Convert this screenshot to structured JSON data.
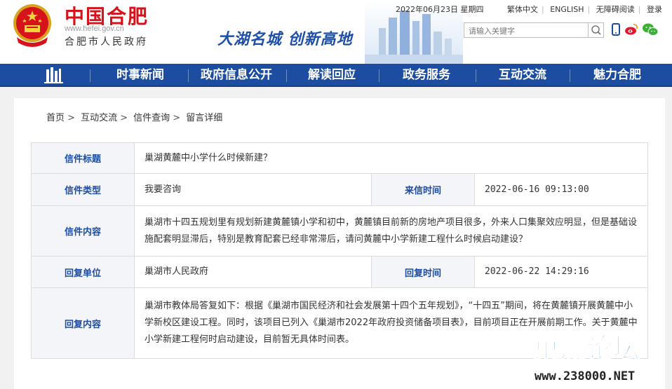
{
  "header": {
    "title": "中国合肥",
    "url": "www.hefei.gov.cn",
    "subtitle": "合肥市人民政府",
    "slogan": "大湖名城  创新高地",
    "date": "2022年06月23日 星期四",
    "links": [
      "繁体中文",
      "ENGLISH",
      "无障碍阅读",
      "登录"
    ],
    "search_placeholder": "请输入关键字"
  },
  "nav": {
    "items": [
      "时事新闻",
      "政府信息公开",
      "解读回应",
      "政务服务",
      "互动交流",
      "魅力合肥"
    ]
  },
  "breadcrumb": [
    "首页",
    "互动交流",
    "信件查询",
    "留言详细"
  ],
  "letter": {
    "title_label": "信件标题",
    "title": "巢湖黄麓中小学什么时候新建？",
    "type_label": "信件类型",
    "type": "我要咨询",
    "received_label": "来信时间",
    "received": "2022-06-16 09:13:00",
    "content_label": "信件内容",
    "content": "巢湖市十四五规划里有规划新建黄麓镇小学和初中，黄麓镇目前新的房地产项目很多，外来人口集聚效应明显，但是基础设施配套明显滞后，特别是教育配套已经非常滞后，请问黄麓中小学新建工程什么时候启动建设？",
    "reply_unit_label": "回复单位",
    "reply_unit": "巢湖市人民政府",
    "reply_time_label": "回复时间",
    "reply_time": "2022-06-22 14:29:16",
    "reply_content_label": "回复内容",
    "reply_content": "巢湖市教体局答复如下：根据《巢湖市国民经济和社会发展第十四个五年规划》，“十四五”期间，将在黄麓镇开展黄麓中小学新校区建设工程。同时，该项目已列入《巢湖市2022年政府投资储备项目表》，目前项目正在开展前期工作。关于黄麓中小学新建工程何时启动建设，目前暂无具体时间表。"
  },
  "watermark": {
    "name": "巢湖论坛",
    "url": "www.238000.NET"
  },
  "colors": {
    "brand_red": "#d6121a",
    "nav_blue": "#1c4da0",
    "label_blue": "#1c4da0"
  }
}
